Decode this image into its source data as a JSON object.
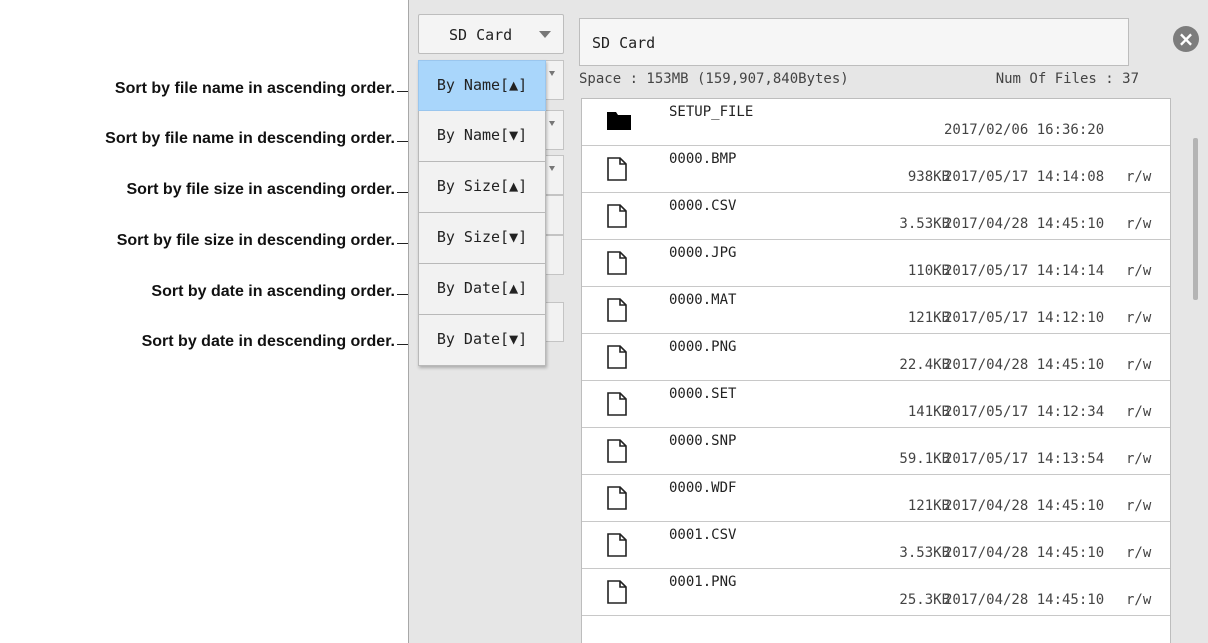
{
  "device_selector": {
    "label": "SD Card"
  },
  "path_display": {
    "value": "SD Card"
  },
  "info": {
    "space": "Space : 153MB (159,907,840Bytes)",
    "num_files": "Num Of Files : 37"
  },
  "sort_menu": {
    "items": [
      {
        "label": "By Name[▲]",
        "selected": true
      },
      {
        "label": "By Name[▼]",
        "selected": false
      },
      {
        "label": "By Size[▲]",
        "selected": false
      },
      {
        "label": "By Size[▼]",
        "selected": false
      },
      {
        "label": "By Date[▲]",
        "selected": false
      },
      {
        "label": "By Date[▼]",
        "selected": false
      }
    ]
  },
  "annotations": [
    "Sort by file name in ascending order.",
    "Sort by file name in descending order.",
    "Sort by file size in ascending order.",
    "Sort by file size in descending order.",
    "Sort by date in ascending order.",
    "Sort by date in descending order."
  ],
  "files": [
    {
      "name": "SETUP_FILE",
      "type": "folder",
      "size": "",
      "date": "2017/02/06 16:36:20",
      "perm": ""
    },
    {
      "name": "0000.BMP",
      "type": "file",
      "size": "938KB",
      "date": "2017/05/17 14:14:08",
      "perm": "r/w"
    },
    {
      "name": "0000.CSV",
      "type": "file",
      "size": "3.53KB",
      "date": "2017/04/28 14:45:10",
      "perm": "r/w"
    },
    {
      "name": "0000.JPG",
      "type": "file",
      "size": "110KB",
      "date": "2017/05/17 14:14:14",
      "perm": "r/w"
    },
    {
      "name": "0000.MAT",
      "type": "file",
      "size": "121KB",
      "date": "2017/05/17 14:12:10",
      "perm": "r/w"
    },
    {
      "name": "0000.PNG",
      "type": "file",
      "size": "22.4KB",
      "date": "2017/04/28 14:45:10",
      "perm": "r/w"
    },
    {
      "name": "0000.SET",
      "type": "file",
      "size": "141KB",
      "date": "2017/05/17 14:12:34",
      "perm": "r/w"
    },
    {
      "name": "0000.SNP",
      "type": "file",
      "size": "59.1KB",
      "date": "2017/05/17 14:13:54",
      "perm": "r/w"
    },
    {
      "name": "0000.WDF",
      "type": "file",
      "size": "121KB",
      "date": "2017/04/28 14:45:10",
      "perm": "r/w"
    },
    {
      "name": "0001.CSV",
      "type": "file",
      "size": "3.53KB",
      "date": "2017/04/28 14:45:10",
      "perm": "r/w"
    },
    {
      "name": "0001.PNG",
      "type": "file",
      "size": "25.3KB",
      "date": "2017/04/28 14:45:10",
      "perm": "r/w"
    }
  ],
  "icons": {
    "close": "close-circle-icon",
    "folder": "folder-icon",
    "file": "file-icon"
  },
  "colors": {
    "selected_menu_bg": "#a9d6fb",
    "panel_bg": "#e6e6e6"
  }
}
